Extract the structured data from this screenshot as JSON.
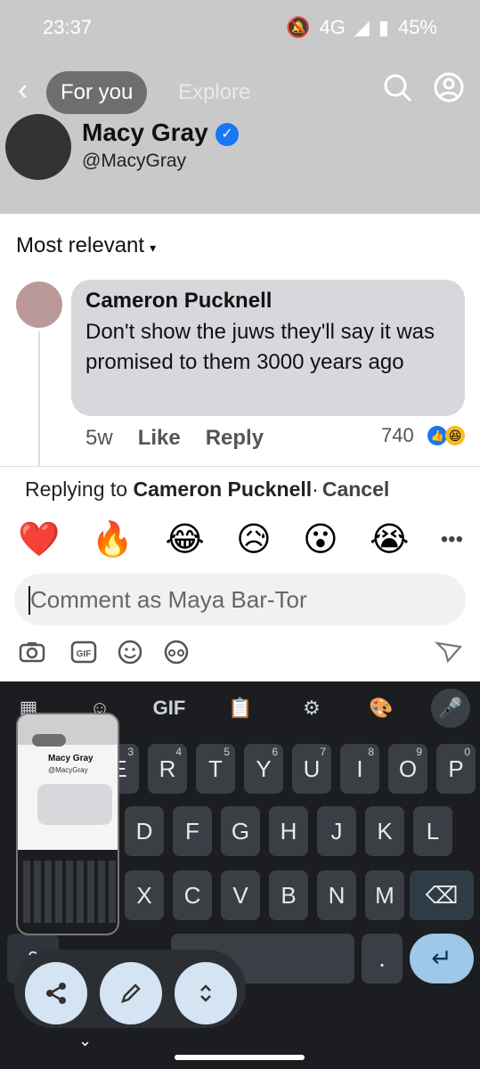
{
  "status": {
    "time": "23:37",
    "network": "4G",
    "battery": "45%"
  },
  "topbar": {
    "active_tab": "For you",
    "tab2": "Explore"
  },
  "page": {
    "name": "Macy Gray",
    "handle": "@MacyGray"
  },
  "comments": {
    "sort_label": "Most relevant",
    "author": "Cameron Pucknell",
    "text": "Don't show the juws  they'll say it was promised to them 3000 years ago",
    "age": "5w",
    "like": "Like",
    "reply": "Reply",
    "reaction_count": "740"
  },
  "reply_bar": {
    "prefix": "Replying to ",
    "name": "Cameron Pucknell",
    "separator": "·",
    "cancel": "Cancel"
  },
  "emojis": [
    "❤️",
    "🔥",
    "😂",
    "😥",
    "😮",
    "😭"
  ],
  "composer": {
    "placeholder": "Comment as Maya Bar-Tor"
  },
  "keyboard": {
    "top": {
      "gif": "GIF"
    },
    "row1": [
      "E",
      "R",
      "T",
      "Y",
      "U",
      "I",
      "O",
      "P"
    ],
    "row1_nums": [
      "3",
      "4",
      "5",
      "6",
      "7",
      "8",
      "9",
      "0"
    ],
    "row2": [
      "D",
      "F",
      "G",
      "H",
      "J",
      "K",
      "L"
    ],
    "row3": [
      "X",
      "C",
      "V",
      "B",
      "N",
      "M"
    ],
    "period": ".",
    "mode": "?"
  },
  "thumbnail": {
    "title": "Macy Gray",
    "sub": "@MacyGray"
  },
  "colors": {
    "accent": "#1877f2",
    "keyboard_bg": "#1b1d20"
  }
}
